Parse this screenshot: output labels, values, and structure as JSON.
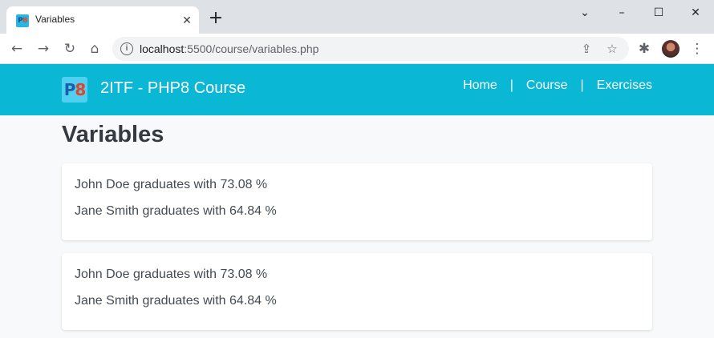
{
  "browser": {
    "tab_title": "Variables",
    "favicon_text_p": "P",
    "favicon_text_8": "8",
    "url_host": "localhost",
    "url_port": ":5500",
    "url_path": "/course/variables.php"
  },
  "navbar": {
    "logo_p": "P",
    "logo_8": "8",
    "brand": "2ITF - PHP8 Course",
    "links": [
      {
        "label": "Home"
      },
      {
        "label": "Course"
      },
      {
        "label": "Exercises"
      }
    ],
    "separator": "|",
    "background_color": "#0ab7d4"
  },
  "main": {
    "title": "Variables",
    "cards": [
      {
        "lines": [
          "John Doe graduates with 73.08 %",
          "Jane Smith graduates with 64.84 %"
        ]
      },
      {
        "lines": [
          "John Doe graduates with 73.08 %",
          "Jane Smith graduates with 64.84 %"
        ]
      }
    ]
  }
}
